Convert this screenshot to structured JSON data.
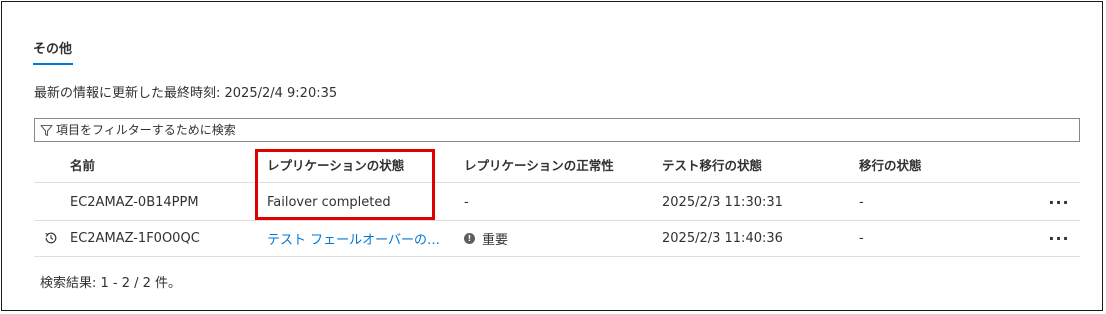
{
  "section": {
    "tab_label": "その他",
    "last_updated": "最新の情報に更新した最終時刻: 2025/2/4 9:20:35"
  },
  "filter": {
    "placeholder": "項目をフィルターするために検索",
    "icon": "filter-icon"
  },
  "table": {
    "headers": {
      "name": "名前",
      "replication_status": "レプリケーションの状態",
      "replication_health": "レプリケーションの正常性",
      "test_migration_status": "テスト移行の状態",
      "migration_status": "移行の状態"
    },
    "rows": [
      {
        "name": "EC2AMAZ-0B14PPM",
        "replication_status": "Failover completed",
        "replication_health": "-",
        "test_migration_status": "2025/2/3 11:30:31",
        "migration_status": "-",
        "more": "···"
      },
      {
        "icon": "history-icon",
        "name": "EC2AMAZ-1F0O0QC",
        "replication_status": "テスト フェールオーバーのクリー…",
        "replication_health": "重要",
        "health_icon": "!",
        "test_migration_status": "2025/2/3 11:40:36",
        "migration_status": "-",
        "more": "···"
      }
    ]
  },
  "footer": {
    "results": "検索結果: 1 - 2 / 2 件。"
  },
  "colors": {
    "accent": "#0078d4",
    "highlight": "#e00000",
    "text": "#323130"
  }
}
